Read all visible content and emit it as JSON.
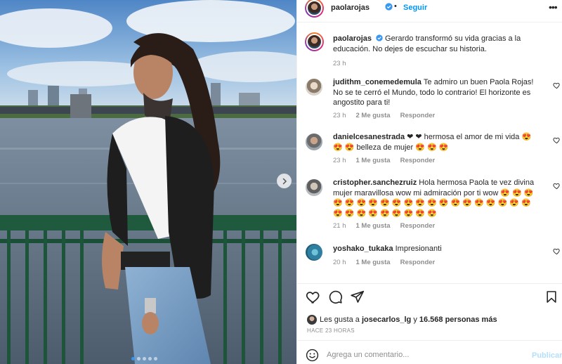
{
  "post": {
    "username": "paolarojas",
    "follow_label": "Seguir",
    "separator": "•",
    "more_glyph": "•••",
    "caption": "Gerardo transformó su vida gracias a la educación. No dejes de escuchar su historia.",
    "caption_time": "23 h"
  },
  "comments": [
    {
      "user": "judithm_conemedemula",
      "text": "Te admiro un buen Paola Rojas! No se te cerró el Mundo, todo lo contrario! El horizonte es angostito para ti!",
      "time": "23 h",
      "likes": "2 Me gusta",
      "reply": "Responder"
    },
    {
      "user": "danielcesanestrada",
      "text": "❤ ❤ hermosa el amor de mi vida 😍 😍 😍 belleza de mujer 😍 😍 😍",
      "time": "23 h",
      "likes": "1 Me gusta",
      "reply": "Responder"
    },
    {
      "user": "cristopher.sanchezruiz",
      "text": "Hola hermosa Paola te vez divina mujer maravillosa wow mi admiración por ti wow 😍 😍 😍 😍 😍 😍 😍 😍 😍 😍 😍 😍 😍 😍 😍 😍 😍 😍 😍 😍 😍 😍 😍 😍 😍 😍 😍 😍 😍",
      "time": "21 h",
      "likes": "1 Me gusta",
      "reply": "Responder"
    },
    {
      "user": "yoshako_tukaka",
      "text": "Impresionanti",
      "time": "20 h",
      "likes": "1 Me gusta",
      "reply": "Responder"
    }
  ],
  "likes": {
    "prefix": "Les gusta a",
    "user": "josecarlos_lg",
    "joiner": "y",
    "count": "16.568 personas más"
  },
  "timestamp": "HACE 23 HORAS",
  "composer": {
    "placeholder": "Agrega un comentario...",
    "publish_label": "Publicar"
  },
  "colors": {
    "accent": "#0095f6",
    "verified": "#3897f0",
    "muted": "#8e8e8e",
    "like_red": "#ed4956"
  },
  "icons": [
    "verified-badge-icon",
    "more-options-icon",
    "heart-icon",
    "comment-icon",
    "share-icon",
    "save-icon",
    "emoji-icon",
    "chevron-right-icon"
  ]
}
